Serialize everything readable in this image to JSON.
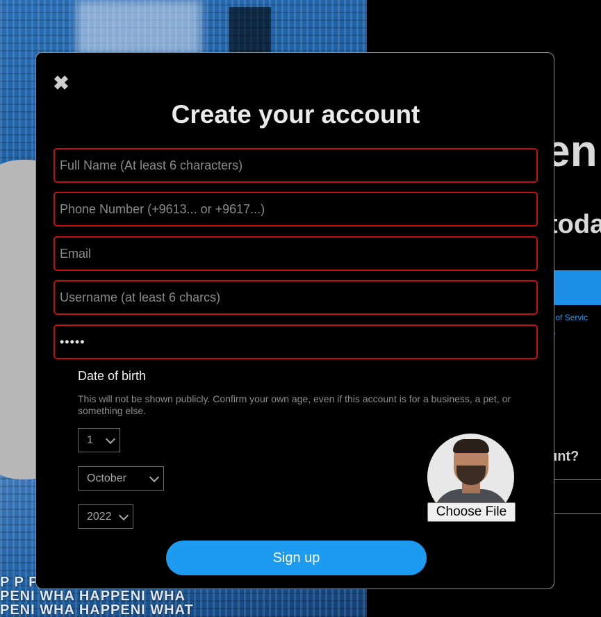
{
  "modal": {
    "close_glyph": "✖",
    "title": "Create your account",
    "fields": {
      "full_name_placeholder": "Full Name (At least 6 characters)",
      "phone_placeholder": "Phone Number (+9613... or +9617...)",
      "email_placeholder": "Email",
      "username_placeholder": "Username (at least 6 charcs)",
      "password_value": "•••••"
    },
    "dob": {
      "label": "Date of birth",
      "note": "This will not be shown publicly. Confirm your own age, even if this account is for a business, a pet, or something else.",
      "day": "1",
      "month": "October",
      "year": "2022"
    },
    "file_button_label": "Choose File",
    "signup_label": "Sign up"
  },
  "background": {
    "title_fragment": "en",
    "subtitle_fragment": "toda",
    "terms_line1": "s of Servic",
    "terms_line2": "e.",
    "account_fragment": "unt?",
    "collage_text_line1": "P  P  P",
    "collage_text_line2": "PENI WHA HAPPENI WHA",
    "collage_text_line3": "PENI WHA HAPPENI WHAT"
  },
  "colors": {
    "field_border": "#c0120f",
    "accent": "#1d9bf0",
    "modal_bg": "#000000"
  },
  "icons": {
    "close": "close-icon",
    "chevron": "chevron-down-icon"
  }
}
